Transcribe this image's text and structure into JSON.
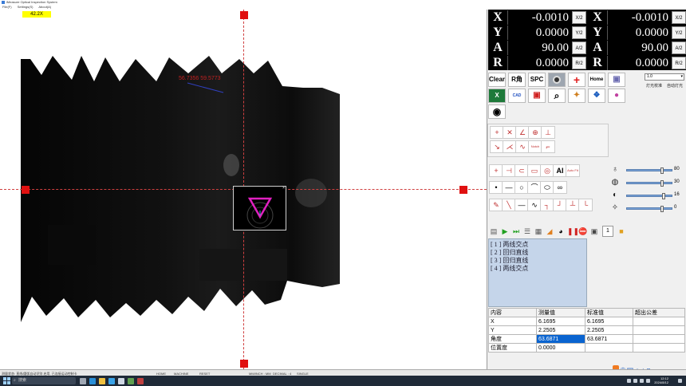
{
  "window": {
    "title": "iMeasure Optical Inspection System"
  },
  "menu": {
    "items": [
      "File(F)",
      "Settings(S)",
      "About(A)"
    ]
  },
  "camera": {
    "zoom": "42.2X",
    "measurement_label": "56.7356 59.5773"
  },
  "dro": {
    "left": [
      {
        "axis": "X",
        "value": "-0.0010",
        "button": "X/2"
      },
      {
        "axis": "Y",
        "value": "0.0000",
        "button": "Y/2"
      },
      {
        "axis": "A",
        "value": "90.00",
        "button": "A/2"
      },
      {
        "axis": "R",
        "value": "0.0000",
        "button": "R/2"
      }
    ],
    "right": [
      {
        "axis": "X",
        "value": "-0.0010",
        "button": "X/2"
      },
      {
        "axis": "Y",
        "value": "0.0000",
        "button": "Y/2"
      },
      {
        "axis": "A",
        "value": "90.00",
        "button": "A/2"
      },
      {
        "axis": "R",
        "value": "0.0000",
        "button": "R/2"
      }
    ]
  },
  "toolbar": {
    "clear": "Clear",
    "r_angle": "R角",
    "spc": "SPC",
    "home": "Home",
    "cad": "CAD",
    "ai": "AI",
    "auto_focus": "Auto Fit",
    "lens_select": "1.0",
    "light_on": "灯光校准",
    "auto_light": "自动灯光",
    "nozhi": "Notch"
  },
  "lights": [
    {
      "name": "surface-light",
      "value": "80",
      "level": 0.8
    },
    {
      "name": "contour-light",
      "value": "30",
      "level": 0.8
    },
    {
      "name": "ring-light",
      "value": "16",
      "level": 0.85
    },
    {
      "name": "coaxial-light",
      "value": "0",
      "level": 0.8
    }
  ],
  "run_bar": {
    "page": "1"
  },
  "features": [
    "[ 1 ] 两线交点",
    "[ 2 ] 回归直线",
    "[ 3 ] 回归直线",
    "[ 4 ] 两线交点"
  ],
  "results": {
    "headers": [
      "内容",
      "测量值",
      "标准值",
      "超出公差"
    ],
    "rows": [
      [
        "X",
        "6.1695",
        "6.1695",
        ""
      ],
      [
        "Y",
        "2.2505",
        "2.2505",
        ""
      ],
      [
        "角度",
        "63.6871",
        "63.6871",
        ""
      ],
      [
        "位置度",
        "0.0000",
        "",
        ""
      ]
    ]
  },
  "statusbar": {
    "left": "测量状态: 直线/圆弧自动识别 启用, 已连接运动控制卡",
    "mode": "HOME",
    "machine": "MACHINE",
    "reset": "RESET",
    "unit": "MM/INCH : MM",
    "decimal": "DECIMAL : 4",
    "extra": "SINGLE"
  },
  "taskbar": {
    "search": "搜索",
    "time": "12:12",
    "date": "2024/8/12"
  },
  "colors": {
    "accent": "#0a64d0",
    "handle": "#e01010",
    "zoom_badge": "#ffff00"
  }
}
